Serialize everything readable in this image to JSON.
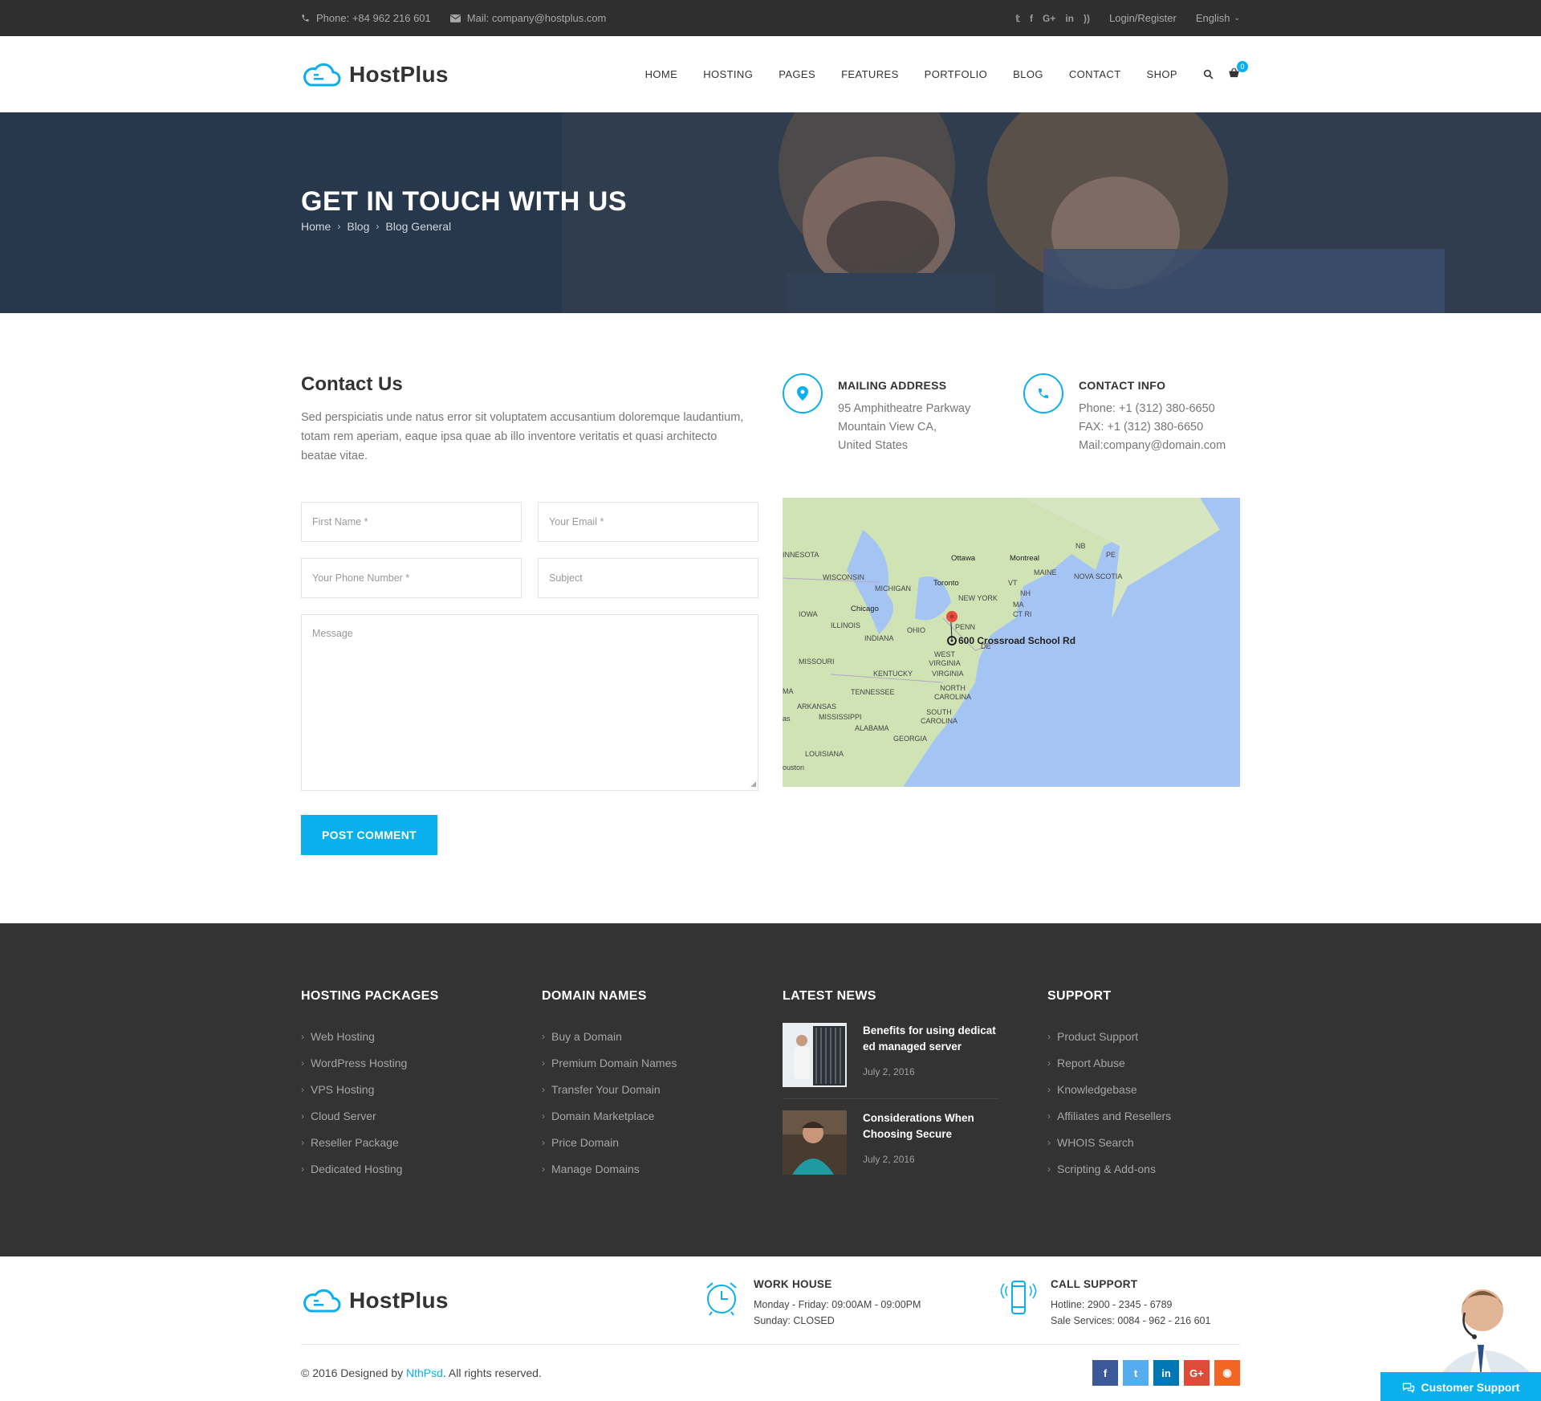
{
  "topbar": {
    "phone": "Phone: +84 962 216 601",
    "mail": "Mail: company@hostplus.com",
    "socials": [
      "twitter-icon",
      "facebook-icon",
      "google-plus-icon",
      "linkedin-icon",
      "rss-icon"
    ],
    "login": "Login/Register",
    "language": "English"
  },
  "header": {
    "brand": "HostPlus",
    "nav": [
      "HOME",
      "HOSTING",
      "PAGES",
      "FEATURES",
      "PORTFOLIO",
      "BLOG",
      "CONTACT",
      "SHOP"
    ],
    "cart_count": "0"
  },
  "hero": {
    "title": "GET IN TOUCH WITH US",
    "breadcrumb": [
      "Home",
      "Blog",
      "Blog General"
    ]
  },
  "contact": {
    "title": "Contact Us",
    "lead": "Sed perspiciatis unde natus error sit voluptatem accusantium doloremque laudantium, totam rem aperiam, eaque ipsa quae ab illo inventore veritatis et quasi architecto beatae vitae.",
    "first_name": "First Name  *",
    "email": "Your Email  *",
    "phone": "Your Phone Number  *",
    "subject": "Subject",
    "message": "Message",
    "submit": "POST COMMENT",
    "mailing": {
      "title": "MAILING ADDRESS",
      "line1": "95 Amphitheatre Parkway",
      "line2": "Mountain View CA,",
      "line3": "United States"
    },
    "info": {
      "title": "CONTACT INFO",
      "phone": "Phone: +1 (312) 380-6650",
      "fax": "FAX: +1 (312) 380-6650",
      "mail": "Mail:company@domain.com"
    },
    "map": {
      "pin_label": "600 Crossroad School Rd",
      "labels": [
        "INNESOTA",
        "WISCONSIN",
        "MICHIGAN",
        "Ottawa",
        "Montreal",
        "NB",
        "PE",
        "MAINE",
        "NOVA SCOTIA",
        "VT",
        "NH",
        "Toronto",
        "NEW YORK",
        "MA",
        "CT RI",
        "IOWA",
        "Chicago",
        "ILLINOIS",
        "INDIANA",
        "OHIO",
        "PENN",
        "DE",
        "MISSOURI",
        "WEST VIRGINIA",
        "KENTUCKY",
        "VIRGINIA",
        "MA",
        "TENNESSEE",
        "NORTH CAROLINA",
        "ARKANSAS",
        "MISSISSIPPI",
        "ALABAMA",
        "SOUTH CAROLINA",
        "as",
        "GEORGIA",
        "LOUISIANA",
        "ouston"
      ]
    }
  },
  "footer": {
    "hosting": {
      "title": "HOSTING PACKAGES",
      "items": [
        "Web Hosting",
        "WordPress Hosting",
        "VPS Hosting",
        "Cloud Server",
        "Reseller Package",
        "Dedicated Hosting"
      ]
    },
    "domains": {
      "title": "DOMAIN NAMES",
      "items": [
        "Buy a Domain",
        "Premium Domain Names",
        "Transfer Your Domain",
        "Domain Marketplace",
        "Price Domain",
        "Manage Domains"
      ]
    },
    "news": {
      "title": "LATEST NEWS",
      "items": [
        {
          "title": "Benefits for using dedicat ed managed server",
          "date": "July 2, 2016"
        },
        {
          "title": "Considerations When Choosing Secure",
          "date": "July 2, 2016"
        }
      ]
    },
    "support": {
      "title": "SUPPORT",
      "items": [
        "Product Support",
        "Report Abuse",
        "Knowledgebase",
        "Affiliates and Resellers",
        "WHOIS Search",
        "Scripting & Add-ons"
      ]
    }
  },
  "bottom": {
    "brand": "HostPlus",
    "work": {
      "title": "WORK HOUSE",
      "line1": "Monday - Friday: 09:00AM - 09:00PM",
      "line2": "Sunday: CLOSED"
    },
    "call": {
      "title": "CALL SUPPORT",
      "line1": "Hotline: 2900 - 2345 - 6789",
      "line2": "Sale Services: 0084 - 962 - 216 601"
    },
    "copyright_pre": "© 2016 Designed by ",
    "copyright_brand": "NthPsd",
    "copyright_post": ". All rights reserved.",
    "socials": [
      {
        "icon": "facebook-icon",
        "glyph": "f",
        "color": "#3b5998"
      },
      {
        "icon": "twitter-icon",
        "glyph": "t",
        "color": "#55acee"
      },
      {
        "icon": "linkedin-icon",
        "glyph": "in",
        "color": "#0077b5"
      },
      {
        "icon": "google-plus-icon",
        "glyph": "G+",
        "color": "#dd4b39"
      },
      {
        "icon": "rss-icon",
        "glyph": "◉",
        "color": "#f26522"
      }
    ],
    "support_label": "Customer Support"
  },
  "colors": {
    "accent": "#0ab0ee",
    "dark": "#333334",
    "topbar": "#2f2f30"
  }
}
